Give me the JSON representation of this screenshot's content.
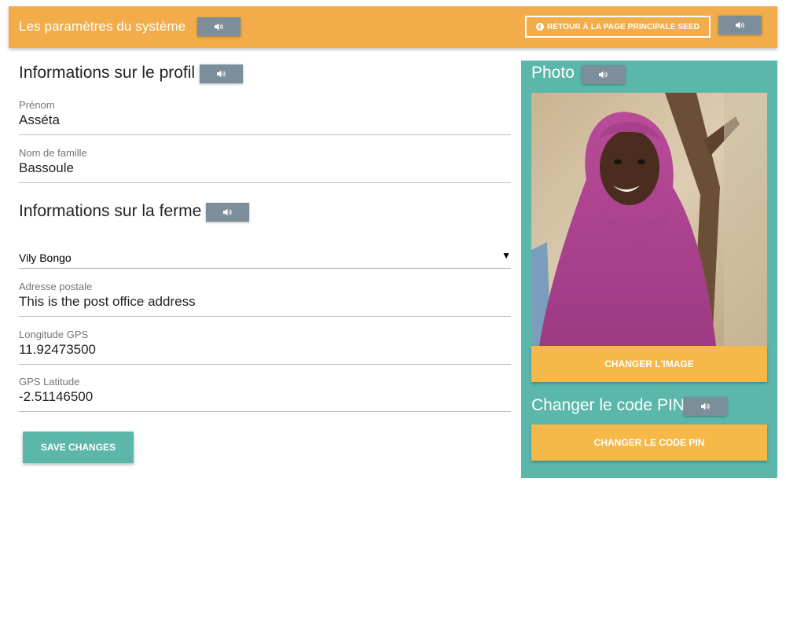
{
  "header": {
    "title": "Les paramètres du système",
    "back_label": "Retour à la page principale SEED"
  },
  "profile": {
    "title": "Informations sur le profil",
    "first_name": {
      "label": "Prénom",
      "value": "Asséta"
    },
    "last_name": {
      "label": "Nom de famille",
      "value": "Bassoule"
    }
  },
  "farm": {
    "title": "Informations sur la ferme",
    "village": {
      "selected": "Vily Bongo"
    },
    "postal": {
      "label": "Adresse postale",
      "value": "This is the post office address"
    },
    "longitude": {
      "label": "Longitude GPS",
      "value": "11.92473500"
    },
    "latitude": {
      "label": "GPS Latitude",
      "value": "-2.51146500"
    }
  },
  "save_label": "Save changes",
  "photo_panel": {
    "title": "Photo",
    "change_image_label": "Changer l'image",
    "pin_title": "Changer le code PIN",
    "change_pin_label": "Changer le code PIN"
  },
  "colors": {
    "header": "#f2ac49",
    "panel": "#5ab7a9",
    "accent_button": "#f5b849",
    "sound_button": "#7d8e9b"
  },
  "icons": [
    "volume-icon",
    "arrow-circle-left-icon",
    "dropdown-arrow-icon"
  ]
}
